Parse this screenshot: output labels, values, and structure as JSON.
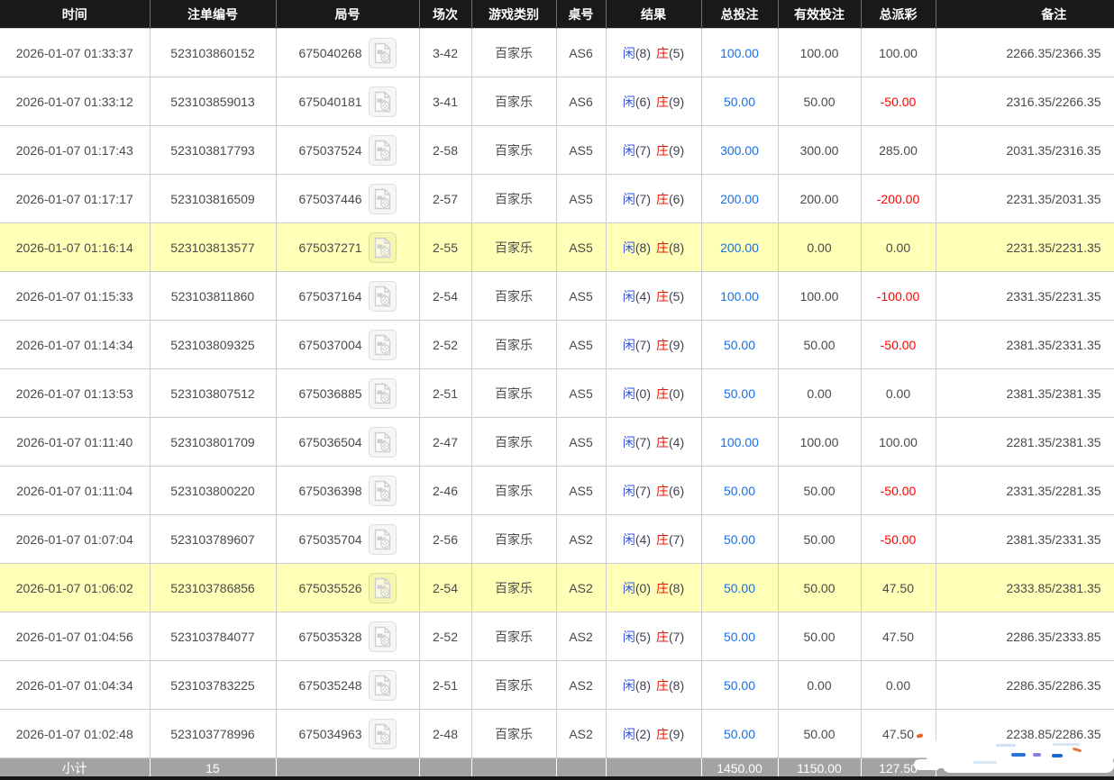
{
  "colors": {
    "header_bg": "#191919",
    "header_text": "#ffffff",
    "row_border": "#cccccc",
    "highlight_row_bg": "#ffffb8",
    "bet_amount_blue": "#1770e4",
    "negative_red": "#ff0000",
    "player_blue": "#3355e0",
    "banker_red": "#f21400",
    "footer_bg": "#a3a3a3",
    "text": "#4a4a4a"
  },
  "table": {
    "columns": [
      {
        "id": "time",
        "label": "时间"
      },
      {
        "id": "bet_no",
        "label": "注单编号"
      },
      {
        "id": "round_no",
        "label": "局号"
      },
      {
        "id": "session",
        "label": "场次"
      },
      {
        "id": "game",
        "label": "游戏类别"
      },
      {
        "id": "table_no",
        "label": "桌号"
      },
      {
        "id": "result",
        "label": "结果"
      },
      {
        "id": "total_bet",
        "label": "总投注"
      },
      {
        "id": "valid_bet",
        "label": "有效投注"
      },
      {
        "id": "payout",
        "label": "总派彩"
      },
      {
        "id": "remark",
        "label": "备注"
      }
    ],
    "rows": [
      {
        "time": "2026-01-07 01:33:37",
        "bet_no": "523103860152",
        "round_no": "675040268",
        "session": "3-42",
        "game": "百家乐",
        "table_no": "AS6",
        "player": "闲",
        "player_pts": "(8)",
        "banker": "庄",
        "banker_pts": "(5)",
        "total_bet": "100.00",
        "valid_bet": "100.00",
        "payout": "100.00",
        "remark": "2266.35/2366.35",
        "highlight": false
      },
      {
        "time": "2026-01-07 01:33:12",
        "bet_no": "523103859013",
        "round_no": "675040181",
        "session": "3-41",
        "game": "百家乐",
        "table_no": "AS6",
        "player": "闲",
        "player_pts": "(6)",
        "banker": "庄",
        "banker_pts": "(9)",
        "total_bet": "50.00",
        "valid_bet": "50.00",
        "payout": "-50.00",
        "remark": "2316.35/2266.35",
        "highlight": false
      },
      {
        "time": "2026-01-07 01:17:43",
        "bet_no": "523103817793",
        "round_no": "675037524",
        "session": "2-58",
        "game": "百家乐",
        "table_no": "AS5",
        "player": "闲",
        "player_pts": "(7)",
        "banker": "庄",
        "banker_pts": "(9)",
        "total_bet": "300.00",
        "valid_bet": "300.00",
        "payout": "285.00",
        "remark": "2031.35/2316.35",
        "highlight": false
      },
      {
        "time": "2026-01-07 01:17:17",
        "bet_no": "523103816509",
        "round_no": "675037446",
        "session": "2-57",
        "game": "百家乐",
        "table_no": "AS5",
        "player": "闲",
        "player_pts": "(7)",
        "banker": "庄",
        "banker_pts": "(6)",
        "total_bet": "200.00",
        "valid_bet": "200.00",
        "payout": "-200.00",
        "remark": "2231.35/2031.35",
        "highlight": false
      },
      {
        "time": "2026-01-07 01:16:14",
        "bet_no": "523103813577",
        "round_no": "675037271",
        "session": "2-55",
        "game": "百家乐",
        "table_no": "AS5",
        "player": "闲",
        "player_pts": "(8)",
        "banker": "庄",
        "banker_pts": "(8)",
        "total_bet": "200.00",
        "valid_bet": "0.00",
        "payout": "0.00",
        "remark": "2231.35/2231.35",
        "highlight": true
      },
      {
        "time": "2026-01-07 01:15:33",
        "bet_no": "523103811860",
        "round_no": "675037164",
        "session": "2-54",
        "game": "百家乐",
        "table_no": "AS5",
        "player": "闲",
        "player_pts": "(4)",
        "banker": "庄",
        "banker_pts": "(5)",
        "total_bet": "100.00",
        "valid_bet": "100.00",
        "payout": "-100.00",
        "remark": "2331.35/2231.35",
        "highlight": false
      },
      {
        "time": "2026-01-07 01:14:34",
        "bet_no": "523103809325",
        "round_no": "675037004",
        "session": "2-52",
        "game": "百家乐",
        "table_no": "AS5",
        "player": "闲",
        "player_pts": "(7)",
        "banker": "庄",
        "banker_pts": "(9)",
        "total_bet": "50.00",
        "valid_bet": "50.00",
        "payout": "-50.00",
        "remark": "2381.35/2331.35",
        "highlight": false
      },
      {
        "time": "2026-01-07 01:13:53",
        "bet_no": "523103807512",
        "round_no": "675036885",
        "session": "2-51",
        "game": "百家乐",
        "table_no": "AS5",
        "player": "闲",
        "player_pts": "(0)",
        "banker": "庄",
        "banker_pts": "(0)",
        "total_bet": "50.00",
        "valid_bet": "0.00",
        "payout": "0.00",
        "remark": "2381.35/2381.35",
        "highlight": false
      },
      {
        "time": "2026-01-07 01:11:40",
        "bet_no": "523103801709",
        "round_no": "675036504",
        "session": "2-47",
        "game": "百家乐",
        "table_no": "AS5",
        "player": "闲",
        "player_pts": "(7)",
        "banker": "庄",
        "banker_pts": "(4)",
        "total_bet": "100.00",
        "valid_bet": "100.00",
        "payout": "100.00",
        "remark": "2281.35/2381.35",
        "highlight": false
      },
      {
        "time": "2026-01-07 01:11:04",
        "bet_no": "523103800220",
        "round_no": "675036398",
        "session": "2-46",
        "game": "百家乐",
        "table_no": "AS5",
        "player": "闲",
        "player_pts": "(7)",
        "banker": "庄",
        "banker_pts": "(6)",
        "total_bet": "50.00",
        "valid_bet": "50.00",
        "payout": "-50.00",
        "remark": "2331.35/2281.35",
        "highlight": false
      },
      {
        "time": "2026-01-07 01:07:04",
        "bet_no": "523103789607",
        "round_no": "675035704",
        "session": "2-56",
        "game": "百家乐",
        "table_no": "AS2",
        "player": "闲",
        "player_pts": "(4)",
        "banker": "庄",
        "banker_pts": "(7)",
        "total_bet": "50.00",
        "valid_bet": "50.00",
        "payout": "-50.00",
        "remark": "2381.35/2331.35",
        "highlight": false
      },
      {
        "time": "2026-01-07 01:06:02",
        "bet_no": "523103786856",
        "round_no": "675035526",
        "session": "2-54",
        "game": "百家乐",
        "table_no": "AS2",
        "player": "闲",
        "player_pts": "(0)",
        "banker": "庄",
        "banker_pts": "(8)",
        "total_bet": "50.00",
        "valid_bet": "50.00",
        "payout": "47.50",
        "remark": "2333.85/2381.35",
        "highlight": true
      },
      {
        "time": "2026-01-07 01:04:56",
        "bet_no": "523103784077",
        "round_no": "675035328",
        "session": "2-52",
        "game": "百家乐",
        "table_no": "AS2",
        "player": "闲",
        "player_pts": "(5)",
        "banker": "庄",
        "banker_pts": "(7)",
        "total_bet": "50.00",
        "valid_bet": "50.00",
        "payout": "47.50",
        "remark": "2286.35/2333.85",
        "highlight": false
      },
      {
        "time": "2026-01-07 01:04:34",
        "bet_no": "523103783225",
        "round_no": "675035248",
        "session": "2-51",
        "game": "百家乐",
        "table_no": "AS2",
        "player": "闲",
        "player_pts": "(8)",
        "banker": "庄",
        "banker_pts": "(8)",
        "total_bet": "50.00",
        "valid_bet": "0.00",
        "payout": "0.00",
        "remark": "2286.35/2286.35",
        "highlight": false
      },
      {
        "time": "2026-01-07 01:02:48",
        "bet_no": "523103778996",
        "round_no": "675034963",
        "session": "2-48",
        "game": "百家乐",
        "table_no": "AS2",
        "player": "闲",
        "player_pts": "(2)",
        "banker": "庄",
        "banker_pts": "(9)",
        "total_bet": "50.00",
        "valid_bet": "50.00",
        "payout": "47.50",
        "remark": "2238.85/2286.35",
        "highlight": false
      }
    ],
    "footer": {
      "label": "小计",
      "count": "15",
      "round_no": "",
      "session": "",
      "game": "",
      "table_no": "",
      "result": "",
      "total_bet": "1450.00",
      "valid_bet": "1150.00",
      "payout": "127.50",
      "remark": ""
    }
  }
}
